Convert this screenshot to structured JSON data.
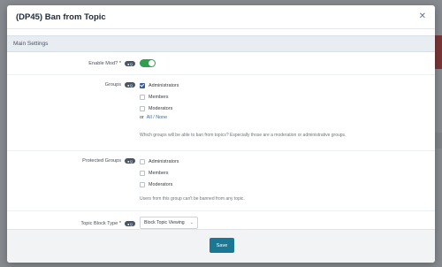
{
  "modal": {
    "title": "(DP45) Ban from Topic",
    "close_icon": "close-icon"
  },
  "section": {
    "title": "Main Settings"
  },
  "enable_mod": {
    "label": "Enable Mod? *",
    "hint": "Q",
    "enabled": true
  },
  "groups": {
    "label": "Groups",
    "hint": "Q",
    "options": [
      {
        "label": "Administrators",
        "checked": true
      },
      {
        "label": "Members",
        "checked": false
      },
      {
        "label": "Moderators",
        "checked": false
      }
    ],
    "or": "or",
    "all_none": "All / None",
    "explain": "Which groups will be able to ban from topics? Especially those are a moderation or administrative groups."
  },
  "protected_groups": {
    "label": "Protected Groups",
    "hint": "Q",
    "options": [
      {
        "label": "Administrators",
        "checked": false
      },
      {
        "label": "Members",
        "checked": false
      },
      {
        "label": "Moderators",
        "checked": false
      }
    ],
    "explain": "Users from this group can't be banned from any topic."
  },
  "block_type": {
    "label": "Topic Block Type *",
    "hint": "Q",
    "value": "Block Topic Viewing"
  },
  "footer": {
    "save_label": "Save"
  },
  "colors": {
    "accent": "#1b7895",
    "toggle_on": "#2e9e4f",
    "checkbox_on": "#2f5aa8"
  }
}
